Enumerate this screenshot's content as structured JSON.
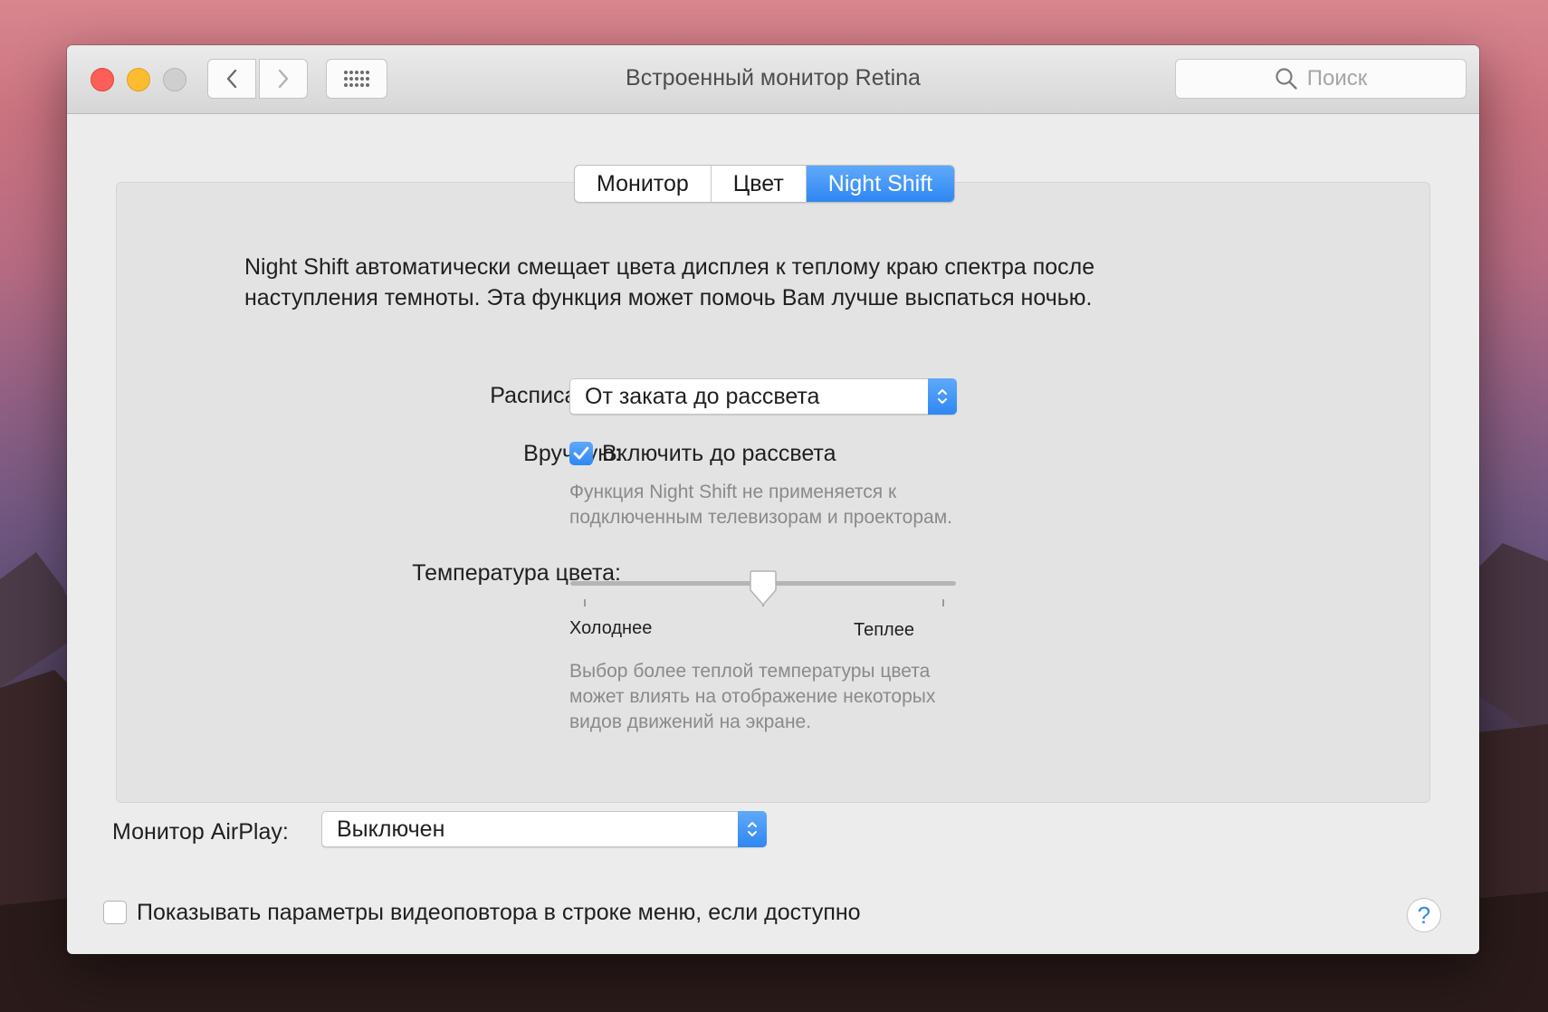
{
  "window": {
    "title": "Встроенный монитор Retina",
    "search_placeholder": "Поиск"
  },
  "tabs": [
    {
      "label": "Монитор",
      "active": false
    },
    {
      "label": "Цвет",
      "active": false
    },
    {
      "label": "Night Shift",
      "active": true
    }
  ],
  "night_shift": {
    "description": "Night Shift автоматически смещает цвета дисплея к теплому краю спектра после наступления темноты. Эта функция может помочь Вам лучше выспаться ночью.",
    "schedule_label": "Расписание:",
    "schedule_value": "От заката до рассвета",
    "manual_label": "Вручную:",
    "manual_checkbox_label": "Включить до рассвета",
    "manual_checked": true,
    "manual_note": "Функция Night Shift не применяется к подключенным телевизорам и проекторам.",
    "temperature_label": "Температура цвета:",
    "temperature_value": 0.5,
    "cooler_label": "Холоднее",
    "warmer_label": "Теплее",
    "temperature_note": "Выбор более теплой температуры цвета может влиять на отображение некоторых видов движений на экране."
  },
  "airplay": {
    "label": "Монитор AirPlay:",
    "value": "Выключен"
  },
  "mirroring": {
    "label": "Показывать параметры видеоповтора в строке меню, если доступно",
    "checked": false
  },
  "help_label": "?",
  "colors": {
    "accent": "#2f87f2",
    "close": "#fc5f57",
    "minimize": "#fdbc2e"
  }
}
